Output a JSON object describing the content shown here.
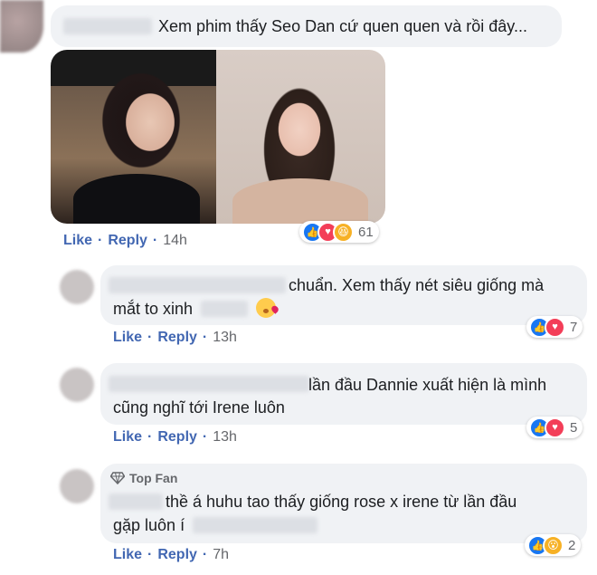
{
  "comments": [
    {
      "text": "Xem phim thấy Seo Dan cứ quen quen và rồi đây...",
      "actions": {
        "like": "Like",
        "reply": "Reply",
        "time": "14h"
      },
      "reactions": {
        "count": "61",
        "icons": [
          "like-icon",
          "love-icon",
          "haha-icon"
        ]
      }
    },
    {
      "text_line1": "chuẩn. Xem thấy nét siêu giống mà",
      "text_line2": "mắt to xinh",
      "actions": {
        "like": "Like",
        "reply": "Reply",
        "time": "13h"
      },
      "reactions": {
        "count": "7",
        "icons": [
          "like-icon",
          "love-icon"
        ]
      }
    },
    {
      "text_line1": "lần đầu Dannie xuất hiện là mình",
      "text_line2": "cũng nghĩ tới Irene luôn",
      "actions": {
        "like": "Like",
        "reply": "Reply",
        "time": "13h"
      },
      "reactions": {
        "count": "5",
        "icons": [
          "like-icon",
          "love-icon"
        ]
      }
    },
    {
      "badge": "Top Fan",
      "text_line1": "thề á huhu tao thấy giống rose x irene từ lần đầu",
      "text_line2": "gặp luôn í",
      "actions": {
        "like": "Like",
        "reply": "Reply",
        "time": "7h"
      },
      "reactions": {
        "count": "2",
        "icons": [
          "like-icon",
          "wow-icon"
        ]
      }
    }
  ],
  "colors": {
    "link": "#4267b2",
    "bubble": "#f0f2f5",
    "like": "#1877f2",
    "love": "#f33e58",
    "haha": "#f7b125"
  }
}
